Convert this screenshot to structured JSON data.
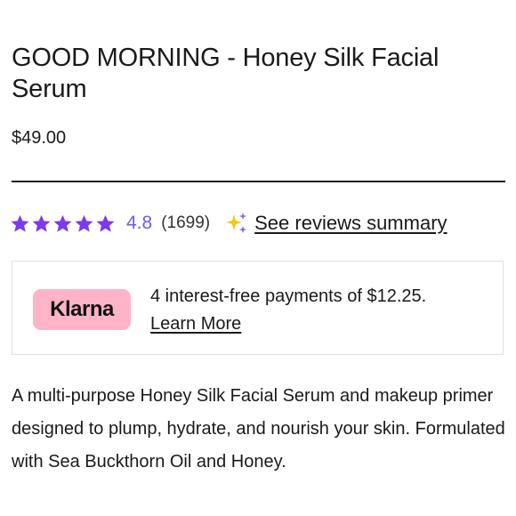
{
  "product": {
    "title": "GOOD MORNING - Honey Silk Facial Serum",
    "price": "$49.00",
    "description": "A multi-purpose Honey Silk Facial Serum and makeup primer designed to plump, hydrate, and nourish your skin. Formulated with Sea Buckthorn Oil and Honey."
  },
  "rating": {
    "value": "4.8",
    "count": "(1699)",
    "stars_filled": 5,
    "stars_total": 5,
    "star_icon": "star-icon",
    "sparkle_icon": "sparkle-icon",
    "reviews_link": "See reviews summary"
  },
  "klarna": {
    "logo_text": "Klarna",
    "message": "4 interest-free payments of $12.25.",
    "learn_more": "Learn More"
  },
  "colors": {
    "star": "#7c3aed",
    "rating_value": "#6c5ce7",
    "klarna_pink": "#ffb3c7",
    "sparkle_yellow": "#f5c518",
    "sparkle_purple": "#8b5cf6"
  }
}
